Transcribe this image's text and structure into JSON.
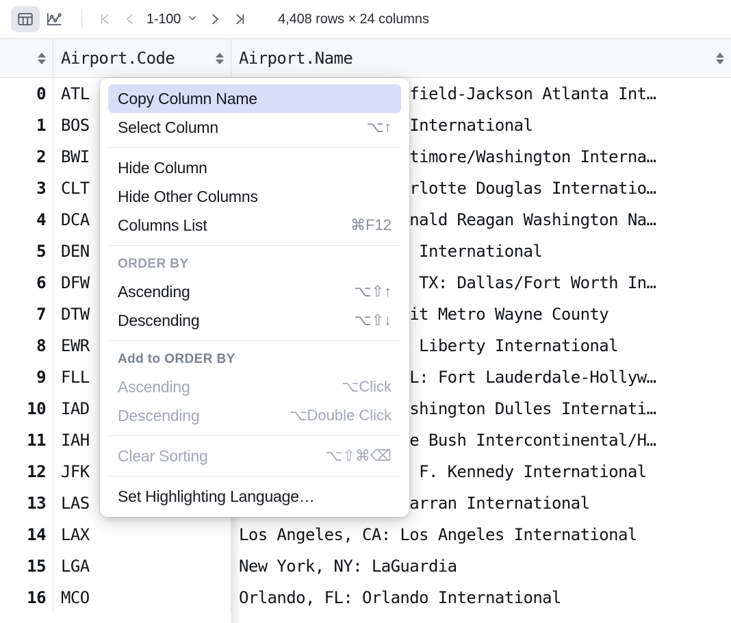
{
  "toolbar": {
    "grid_view_icon": "table-grid-icon",
    "chart_view_icon": "line-chart-icon",
    "first_page_icon": "first-page-icon",
    "prev_page_icon": "previous-page-icon",
    "next_page_icon": "next-page-icon",
    "last_page_icon": "last-page-icon",
    "page_range": "1-100",
    "page_range_chevron": "chevron-down-icon",
    "rows_cols_summary": "4,408 rows × 24 columns"
  },
  "table": {
    "columns": [
      {
        "key": "rownum",
        "label": ""
      },
      {
        "key": "code",
        "label": "Airport.Code"
      },
      {
        "key": "name",
        "label": "Airport.Name"
      }
    ],
    "rows": [
      {
        "index": "0",
        "code": "ATL",
        "name": "Atlanta, GA: Hartsfield-Jackson Atlanta Int…"
      },
      {
        "index": "1",
        "code": "BOS",
        "name": "Boston, MA: Logan International"
      },
      {
        "index": "2",
        "code": "BWI",
        "name": "Baltimore, MD: Baltimore/Washington Interna…"
      },
      {
        "index": "3",
        "code": "CLT",
        "name": "Charlotte, NC: Charlotte Douglas Internatio…"
      },
      {
        "index": "4",
        "code": "DCA",
        "name": "Washington, DC: Ronald Reagan Washington Na…"
      },
      {
        "index": "5",
        "code": "DEN",
        "name": "Denver, CO: Denver International"
      },
      {
        "index": "6",
        "code": "DFW",
        "name": "Dallas/Fort Worth, TX: Dallas/Fort Worth In…"
      },
      {
        "index": "7",
        "code": "DTW",
        "name": "Detroit, MI: Detroit Metro Wayne County"
      },
      {
        "index": "8",
        "code": "EWR",
        "name": "Newark, NJ: Newark Liberty International"
      },
      {
        "index": "9",
        "code": "FLL",
        "name": "Fort Lauderdale, FL: Fort Lauderdale-Hollyw…"
      },
      {
        "index": "10",
        "code": "IAD",
        "name": "Washington, DC: Washington Dulles Internati…"
      },
      {
        "index": "11",
        "code": "IAH",
        "name": "Houston, TX: George Bush Intercontinental/H…"
      },
      {
        "index": "12",
        "code": "JFK",
        "name": "New York, NY: John F. Kennedy International"
      },
      {
        "index": "13",
        "code": "LAS",
        "name": "Las Vegas, NV: McCarran International"
      },
      {
        "index": "14",
        "code": "LAX",
        "name": "Los Angeles, CA: Los Angeles International"
      },
      {
        "index": "15",
        "code": "LGA",
        "name": "New York, NY: LaGuardia"
      },
      {
        "index": "16",
        "code": "MCO",
        "name": "Orlando, FL: Orlando International"
      }
    ]
  },
  "context_menu": {
    "items": [
      {
        "type": "item",
        "id": "copy-column-name",
        "label": "Copy Column Name",
        "shortcut": "",
        "state": "selected"
      },
      {
        "type": "item",
        "id": "select-column",
        "label": "Select Column",
        "shortcut": "⌥↑",
        "state": "normal"
      },
      {
        "type": "separator",
        "id": "separator-1"
      },
      {
        "type": "item",
        "id": "hide-column",
        "label": "Hide Column",
        "shortcut": "",
        "state": "normal"
      },
      {
        "type": "item",
        "id": "hide-other-columns",
        "label": "Hide Other Columns",
        "shortcut": "",
        "state": "normal"
      },
      {
        "type": "item",
        "id": "columns-list",
        "label": "Columns List",
        "shortcut": "⌘F12",
        "state": "normal"
      },
      {
        "type": "separator",
        "id": "separator-2"
      },
      {
        "type": "group",
        "id": "group-order-by",
        "label": "ORDER BY",
        "emphasis": "light"
      },
      {
        "type": "item",
        "id": "order-by-ascending",
        "label": "Ascending",
        "shortcut": "⌥⇧↑",
        "state": "normal"
      },
      {
        "type": "item",
        "id": "order-by-descending",
        "label": "Descending",
        "shortcut": "⌥⇧↓",
        "state": "normal"
      },
      {
        "type": "separator",
        "id": "separator-3"
      },
      {
        "type": "group",
        "id": "group-add-to-order-by",
        "label": "Add to ORDER BY",
        "emphasis": "strong"
      },
      {
        "type": "item",
        "id": "add-order-by-ascending",
        "label": "Ascending",
        "shortcut": "⌥Click",
        "state": "disabled"
      },
      {
        "type": "item",
        "id": "add-order-by-descending",
        "label": "Descending",
        "shortcut": "⌥Double Click",
        "state": "disabled"
      },
      {
        "type": "separator",
        "id": "separator-4"
      },
      {
        "type": "item",
        "id": "clear-sorting",
        "label": "Clear Sorting",
        "shortcut": "⌥⇧⌘⌫",
        "state": "disabled"
      },
      {
        "type": "separator",
        "id": "separator-5"
      },
      {
        "type": "item",
        "id": "set-highlighting-language",
        "label": "Set Highlighting Language…",
        "shortcut": "",
        "state": "normal"
      }
    ]
  },
  "colors": {
    "selection": "#d7deF7",
    "toolbar_border": "#e3e5e8",
    "header_bg": "#f7f8f9",
    "text": "#15181d",
    "muted": "#8a8f99"
  }
}
